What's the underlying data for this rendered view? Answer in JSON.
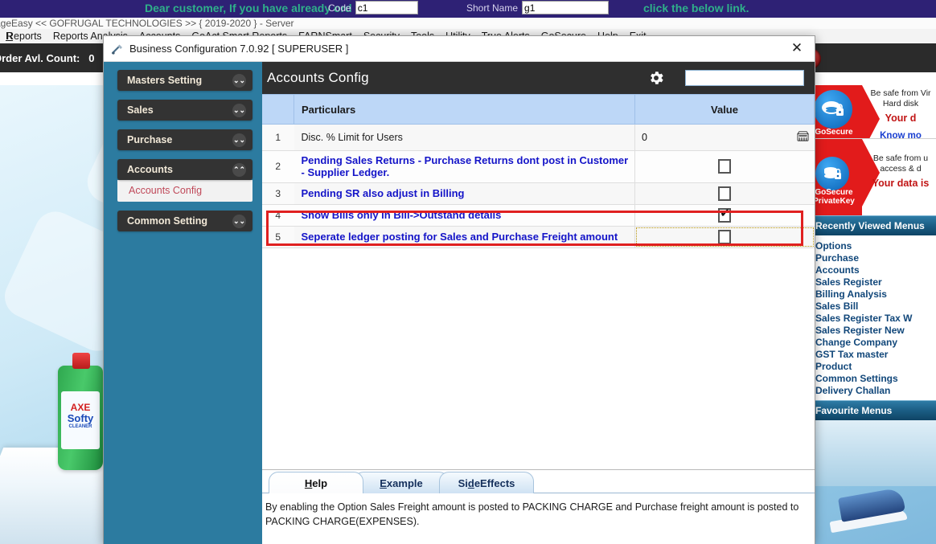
{
  "background": {
    "banner": {
      "marquee_left": "Dear customer, If you have already ord",
      "marquee_right": "click the below link.",
      "fields": [
        {
          "label": "Code",
          "value": "c1"
        },
        {
          "label": "Short Name",
          "value": "g1"
        }
      ]
    },
    "title_strip": "ageEasy << GOFRUGAL TECHNOLOGIES >> { 2019-2020 } - Server",
    "menu_items": [
      {
        "label": "Reports",
        "hotkey": "R"
      },
      {
        "label": "Reports Analysis",
        "hotkey": ""
      },
      {
        "label": "Accounts",
        "hotkey": ""
      },
      {
        "label": "GoAct Smart Reports",
        "hotkey": ""
      },
      {
        "label": "FARNSmart",
        "hotkey": ""
      },
      {
        "label": "Security",
        "hotkey": ""
      },
      {
        "label": "Tools",
        "hotkey": ""
      },
      {
        "label": "Utility",
        "hotkey": ""
      },
      {
        "label": "True Alerts",
        "hotkey": ""
      },
      {
        "label": "GoSecure",
        "hotkey": ""
      },
      {
        "label": "Help",
        "hotkey": ""
      },
      {
        "label": "Exit",
        "hotkey": ""
      }
    ],
    "toolbar": {
      "order_count_label": "Order Avl. Count:",
      "order_count_value": "0"
    }
  },
  "promos": [
    {
      "logo_name": "GoSecure",
      "line1": "Be safe from Vir",
      "line2": "Hard disk",
      "strong": "Your d",
      "link": "Know mo"
    },
    {
      "logo_name": "GoSecure PrivateKey",
      "line1": "Be safe from u",
      "line2": "access & d",
      "strong": "Your data is",
      "link": ""
    }
  ],
  "recently_viewed": {
    "title": "Recently Viewed Menus",
    "items": [
      "Options",
      "Purchase",
      "Accounts",
      "Sales Register",
      "Billing Analysis",
      "Sales Bill",
      "Sales Register Tax W",
      "Sales Register New",
      "Change Company",
      "GST Tax master",
      "Product",
      "Common Settings",
      "Delivery Challan"
    ]
  },
  "favourite_menus": {
    "title": "Favourite Menus"
  },
  "dialog": {
    "title": "Business Configuration 7.0.92 [ SUPERUSER ]",
    "close_label": "✕",
    "sidebar": [
      {
        "label": "Masters Setting",
        "expanded": false,
        "chevron": "⌄⌄"
      },
      {
        "label": "Sales",
        "expanded": false,
        "chevron": "⌄⌄"
      },
      {
        "label": "Purchase",
        "expanded": false,
        "chevron": "⌄⌄"
      },
      {
        "label": "Accounts",
        "expanded": true,
        "chevron": "⌃⌃",
        "sub_item": "Accounts Config"
      },
      {
        "label": "Common Setting",
        "expanded": false,
        "chevron": "⌄⌄"
      }
    ],
    "page_title": "Accounts Config",
    "search_value": "",
    "search_placeholder": "",
    "table": {
      "headers": {
        "num": "",
        "particulars": "Particulars",
        "value": "Value"
      },
      "rows": [
        {
          "num": "1",
          "particulars": "Disc. %  Limit for Users",
          "style": "plain",
          "value_type": "text",
          "value": "0",
          "has_calc_icon": true,
          "selected": false
        },
        {
          "num": "2",
          "particulars": "Pending Sales Returns - Purchase Returns dont post in Customer - Supplier Ledger.",
          "style": "blue",
          "value_type": "checkbox",
          "checked": false,
          "selected": false
        },
        {
          "num": "3",
          "particulars": "Pending SR also adjust in Billing",
          "style": "blue",
          "value_type": "checkbox",
          "checked": false,
          "selected": false
        },
        {
          "num": "4",
          "particulars": "Show Bills only in Bill->Outstand details",
          "style": "blue",
          "value_type": "checkbox",
          "checked": true,
          "selected": false
        },
        {
          "num": "5",
          "particulars": "Seperate ledger posting for Sales and Purchase Freight amount",
          "style": "blue",
          "value_type": "checkbox",
          "checked": false,
          "selected": true
        }
      ]
    },
    "tabs": [
      {
        "label": "Help",
        "hotkey": "H",
        "active": true
      },
      {
        "label": "Example",
        "hotkey": "E",
        "active": false
      },
      {
        "label": "SideEffects",
        "hotkey": "d",
        "active": false
      }
    ],
    "help_text": "By enabling the Option Sales Freight amount is posted to PACKING CHARGE and Purchase freight amount is posted to PACKING CHARGE(EXPENSES)."
  },
  "colors": {
    "dialog_sidebar": "#2c7ba0",
    "header_dark": "#2f2f2f",
    "table_header": "#bdd7f7",
    "row_blue_text": "#1414c8",
    "selection_red": "#e02020",
    "promo_red": "#e21b1b",
    "panel_blue": "#1b5d84"
  }
}
